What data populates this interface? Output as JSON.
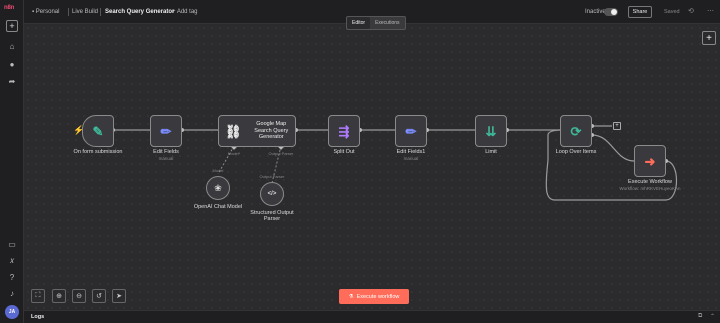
{
  "sidebar": {
    "logo": "n8n",
    "plus_icon": "+",
    "items": [
      {
        "icon": "home-icon",
        "glyph": "⌂"
      },
      {
        "icon": "user-icon",
        "glyph": "●"
      },
      {
        "icon": "share-icon",
        "glyph": "➦"
      }
    ],
    "bottom_items": [
      {
        "icon": "box-icon",
        "glyph": "▭"
      },
      {
        "icon": "variables-icon",
        "glyph": "𝑥"
      },
      {
        "icon": "help-icon",
        "glyph": "?"
      },
      {
        "icon": "bell-icon",
        "glyph": "♪"
      }
    ],
    "avatar": "JA"
  },
  "header": {
    "project": "Personal",
    "folder": "Live Build",
    "title": "Search Query Generator",
    "add_tag": "+ Add tag",
    "status": "Inactive",
    "share": "Share",
    "save": "Saved"
  },
  "tabs": [
    {
      "label": "Editor",
      "active": true
    },
    {
      "label": "Executions",
      "active": false
    }
  ],
  "canvas": {
    "add_node": "+",
    "nodes": [
      {
        "id": "form",
        "title": "On form submission",
        "subtitle": "",
        "icon": "form-icon",
        "glyph": "✎",
        "color": "#3fb89a"
      },
      {
        "id": "edit1",
        "title": "Edit Fields",
        "subtitle": "manual",
        "icon": "pencil-icon",
        "glyph": "✏",
        "color": "#7b8cff"
      },
      {
        "id": "gmap",
        "title": "Google Map Search Query Generator",
        "icon": "link-icon",
        "glyph": "⛓",
        "color": "#eeeeee"
      },
      {
        "id": "split",
        "title": "Split Out",
        "subtitle": "",
        "icon": "split-icon",
        "glyph": "⇶",
        "color": "#b07bff"
      },
      {
        "id": "edit2",
        "title": "Edit Fields1",
        "subtitle": "manual",
        "icon": "pencil-icon",
        "glyph": "✏",
        "color": "#7b8cff"
      },
      {
        "id": "limit",
        "title": "Limit",
        "subtitle": "",
        "icon": "limit-icon",
        "glyph": "⇊",
        "color": "#3fb89a"
      },
      {
        "id": "loop",
        "title": "Loop Over Items",
        "subtitle": "",
        "icon": "loop-icon",
        "glyph": "⟳",
        "color": "#3fb89a"
      },
      {
        "id": "exec",
        "title": "Execute Workflow",
        "subtitle": "Workflow: mhRKVEHuyeoKAn",
        "icon": "execute-icon",
        "glyph": "➜",
        "color": "#ff6d5a"
      }
    ],
    "sub_nodes": [
      {
        "id": "openai",
        "title": "OpenAI Chat Model",
        "icon": "openai-icon",
        "glyph": "❀",
        "port": "Model"
      },
      {
        "id": "parser",
        "title": "Structured Output Parser",
        "icon": "code-icon",
        "glyph": "</>",
        "port": "Output Parser"
      }
    ],
    "gmap_ports": {
      "model": "Model*",
      "parser": "Output Parser"
    }
  },
  "controls": {
    "fit": "⛶",
    "zoom_in": "⊕",
    "zoom_out": "⊖",
    "undo": "↺",
    "select": "➤"
  },
  "execute_button": "Execute workflow",
  "logs": {
    "label": "Logs"
  }
}
